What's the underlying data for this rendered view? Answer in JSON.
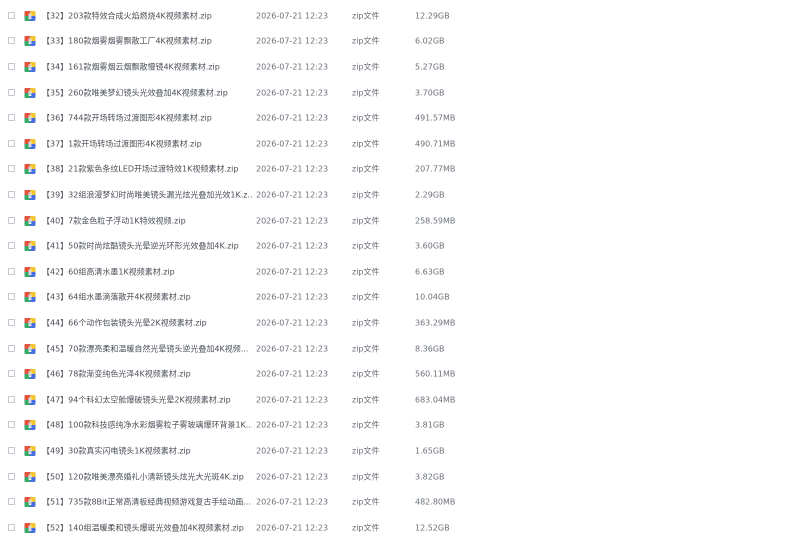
{
  "files": [
    {
      "name": "【32】203款特效合成火焰燃烧4K视频素材.zip",
      "date": "2026-07-21 12:23",
      "type": "zip文件",
      "size": "12.29GB"
    },
    {
      "name": "【33】180款烟雾烟雾飘散工厂4K视频素材.zip",
      "date": "2026-07-21 12:23",
      "type": "zip文件",
      "size": "6.02GB"
    },
    {
      "name": "【34】161款烟雾烟云烟飘散慢镜4K视频素材.zip",
      "date": "2026-07-21 12:23",
      "type": "zip文件",
      "size": "5.27GB"
    },
    {
      "name": "【35】260款唯美梦幻镜头光效叠加4K视频素材.zip",
      "date": "2026-07-21 12:23",
      "type": "zip文件",
      "size": "3.70GB"
    },
    {
      "name": "【36】744款开场转场过渡图形4K视频素材.zip",
      "date": "2026-07-21 12:23",
      "type": "zip文件",
      "size": "491.57MB"
    },
    {
      "name": "【37】1款开场转场过渡图形4K视频素材.zip",
      "date": "2026-07-21 12:23",
      "type": "zip文件",
      "size": "490.71MB"
    },
    {
      "name": "【38】21款紫色条纹LED开场过渡特效1K视频素材.zip",
      "date": "2026-07-21 12:23",
      "type": "zip文件",
      "size": "207.77MB"
    },
    {
      "name": "【39】32组浪漫梦幻时尚唯美镜头漏光炫光叠加光效1K.z...",
      "date": "2026-07-21 12:23",
      "type": "zip文件",
      "size": "2.29GB"
    },
    {
      "name": "【40】7款金色粒子浮动1K特效视频.zip",
      "date": "2026-07-21 12:23",
      "type": "zip文件",
      "size": "258.59MB"
    },
    {
      "name": "【41】50款时尚炫酷镜头光晕逆光环形光效叠加4K.zip",
      "date": "2026-07-21 12:23",
      "type": "zip文件",
      "size": "3.60GB"
    },
    {
      "name": "【42】60组高清水墨1K视频素材.zip",
      "date": "2026-07-21 12:23",
      "type": "zip文件",
      "size": "6.63GB"
    },
    {
      "name": "【43】64组水墨滴落散开4K视频素材.zip",
      "date": "2026-07-21 12:23",
      "type": "zip文件",
      "size": "10.04GB"
    },
    {
      "name": "【44】66个动作包装镜头光晕2K视频素材.zip",
      "date": "2026-07-21 12:23",
      "type": "zip文件",
      "size": "363.29MB"
    },
    {
      "name": "【45】70款漂亮柔和温暖自然光晕镜头逆光叠加4K视频...",
      "date": "2026-07-21 12:23",
      "type": "zip文件",
      "size": "8.36GB"
    },
    {
      "name": "【46】78款渐变纯色光泽4K视频素材.zip",
      "date": "2026-07-21 12:23",
      "type": "zip文件",
      "size": "560.11MB"
    },
    {
      "name": "【47】94个科幻太空舱爆破镜头光晕2K视频素材.zip",
      "date": "2026-07-21 12:23",
      "type": "zip文件",
      "size": "683.04MB"
    },
    {
      "name": "【48】100款科技感纯净水彩烟雾粒子雾玻璃爆环背景1K...",
      "date": "2026-07-21 12:23",
      "type": "zip文件",
      "size": "3.81GB"
    },
    {
      "name": "【49】30款真实闪电镜头1K视频素材.zip",
      "date": "2026-07-21 12:23",
      "type": "zip文件",
      "size": "1.65GB"
    },
    {
      "name": "【50】120款唯美漂亮婚礼小清新镜头炫光大光斑4K.zip",
      "date": "2026-07-21 12:23",
      "type": "zip文件",
      "size": "3.82GB"
    },
    {
      "name": "【51】735款8Bit正常高清板经典视频游戏复古手绘动画...",
      "date": "2026-07-21 12:23",
      "type": "zip文件",
      "size": "482.80MB"
    },
    {
      "name": "【52】140组温暖柔和镜头爆斑光效叠加4K视频素材.zip",
      "date": "2026-07-21 12:23",
      "type": "zip文件",
      "size": "12.52GB"
    }
  ],
  "icon": "zip-archive-icon"
}
